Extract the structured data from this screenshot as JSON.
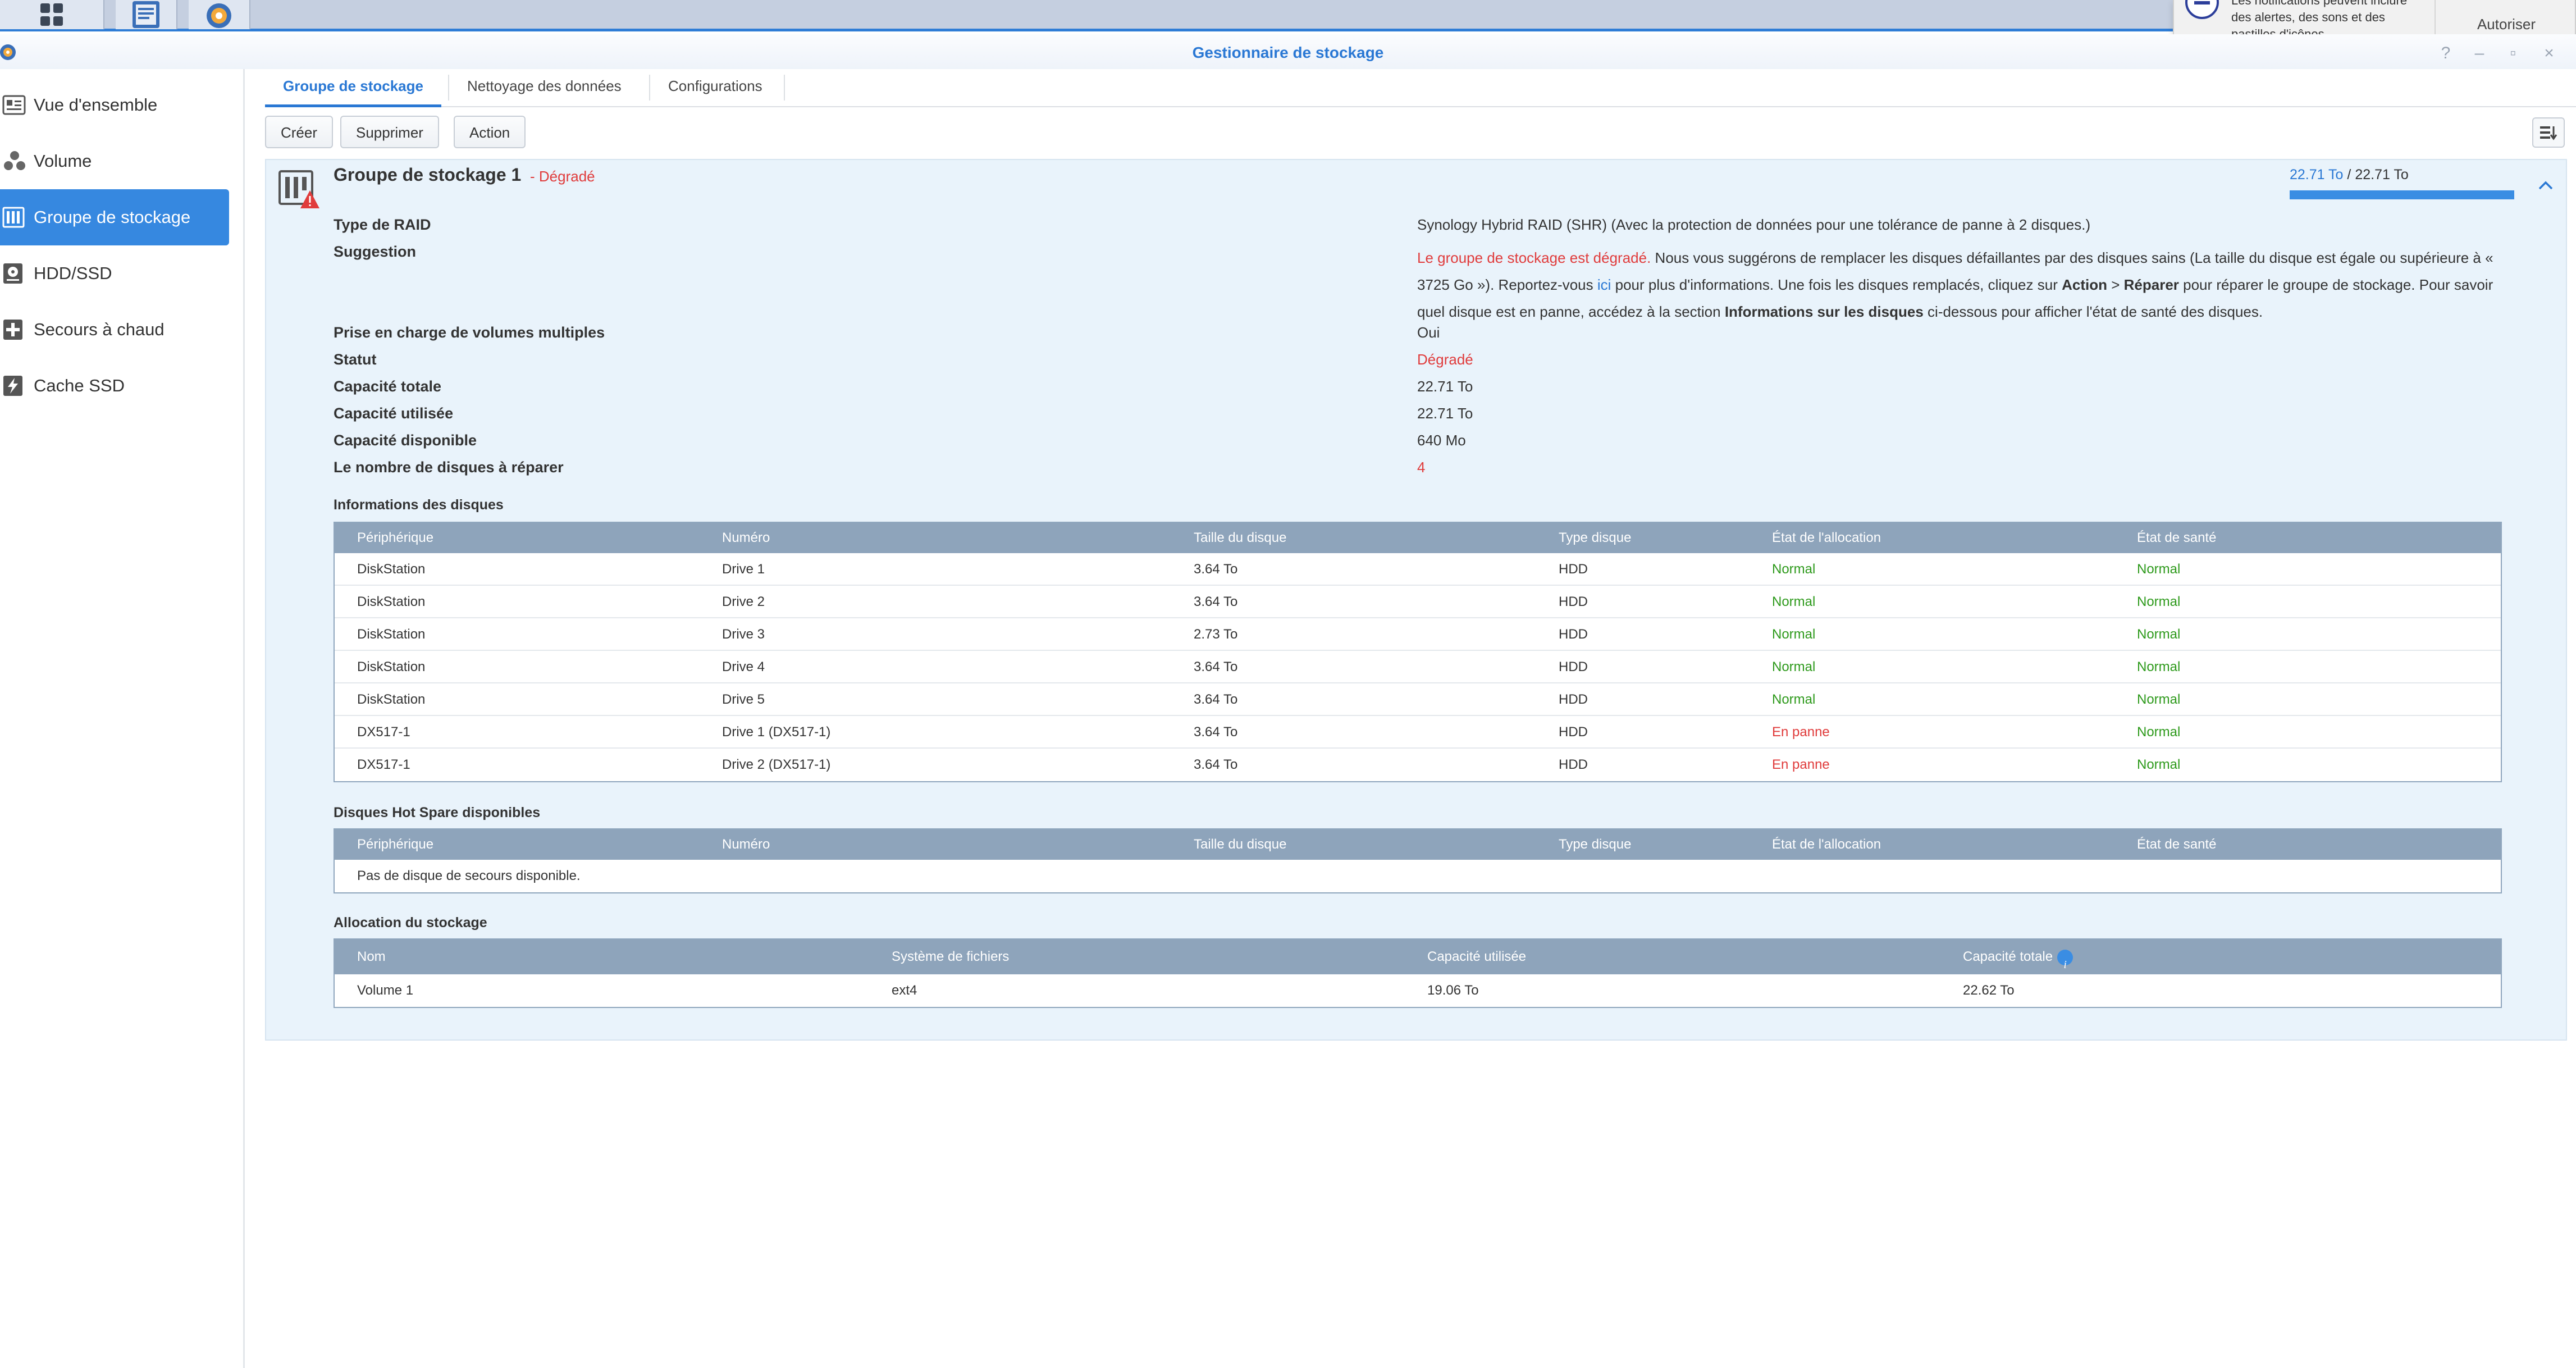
{
  "notification": {
    "text": "Les notifications peuvent inclure des alertes, des sons et des pastilles d'icônes.",
    "button": "Autoriser"
  },
  "window": {
    "title": "Gestionnaire de stockage",
    "controls": [
      "?",
      "–",
      "▫",
      "×"
    ]
  },
  "sidebar": {
    "items": [
      {
        "label": "Vue d'ensemble",
        "icon": "overview-icon"
      },
      {
        "label": "Volume",
        "icon": "volume-icon"
      },
      {
        "label": "Groupe de stockage",
        "icon": "storage-pool-icon",
        "active": true
      },
      {
        "label": "HDD/SSD",
        "icon": "hdd-icon"
      },
      {
        "label": "Secours à chaud",
        "icon": "hot-spare-icon"
      },
      {
        "label": "Cache SSD",
        "icon": "ssd-cache-icon"
      }
    ]
  },
  "tabs": [
    "Groupe de stockage",
    "Nettoyage des données",
    "Configurations"
  ],
  "toolbar": {
    "create": "Créer",
    "delete": "Supprimer",
    "action": "Action"
  },
  "pool": {
    "name": "Groupe de stockage 1",
    "status_suffix": "- Dégradé",
    "usage_used": "22.71 To",
    "usage_sep": " / ",
    "usage_total": "22.71 To",
    "usage_fraction": 1.0,
    "labels": {
      "raid_type": "Type de RAID",
      "suggestion": "Suggestion",
      "multi_volume": "Prise en charge de volumes multiples",
      "status": "Statut",
      "total_capacity": "Capacité totale",
      "used_capacity": "Capacité utilisée",
      "available_capacity": "Capacité disponible",
      "disks_to_repair": "Le nombre de disques à réparer"
    },
    "values": {
      "raid_type": "Synology Hybrid RAID (SHR) (Avec la protection de données pour une tolérance de panne à 2 disques.)",
      "multi_volume": "Oui",
      "status": "Dégradé",
      "total_capacity": "22.71 To",
      "used_capacity": "22.71 To",
      "available_capacity": "640 Mo",
      "disks_to_repair": "4"
    },
    "suggestion": {
      "p1_red": "Le groupe de stockage est dégradé.",
      "p2": " Nous vous suggérons de remplacer les disques défaillantes par des disques sains (La taille du disque est égale ou supérieure à « 3725 Go »). Reportez-vous ",
      "p3_link": "ici",
      "p4": " pour plus d'informations. Une fois les disques remplacés, cliquez sur ",
      "p5_bold": "Action",
      "p6": " > ",
      "p7_bold": "Réparer",
      "p8": " pour réparer le groupe de stockage. Pour savoir quel disque est en panne, accédez à la section ",
      "p9_bold": "Informations sur les disques",
      "p10": " ci-dessous pour afficher l'état de santé des disques."
    }
  },
  "disk_info": {
    "title": "Informations des disques",
    "columns": [
      "Périphérique",
      "Numéro",
      "Taille du disque",
      "Type disque",
      "État de l'allocation",
      "État de santé"
    ],
    "rows": [
      {
        "device": "DiskStation",
        "number": "Drive 1",
        "size": "3.64 To",
        "type": "HDD",
        "allocation": "Normal",
        "health": "Normal"
      },
      {
        "device": "DiskStation",
        "number": "Drive 2",
        "size": "3.64 To",
        "type": "HDD",
        "allocation": "Normal",
        "health": "Normal"
      },
      {
        "device": "DiskStation",
        "number": "Drive 3",
        "size": "2.73 To",
        "type": "HDD",
        "allocation": "Normal",
        "health": "Normal"
      },
      {
        "device": "DiskStation",
        "number": "Drive 4",
        "size": "3.64 To",
        "type": "HDD",
        "allocation": "Normal",
        "health": "Normal"
      },
      {
        "device": "DiskStation",
        "number": "Drive 5",
        "size": "3.64 To",
        "type": "HDD",
        "allocation": "Normal",
        "health": "Normal"
      },
      {
        "device": "DX517-1",
        "number": "Drive 1 (DX517-1)",
        "size": "3.64 To",
        "type": "HDD",
        "allocation": "En panne",
        "health": "Normal"
      },
      {
        "device": "DX517-1",
        "number": "Drive 2 (DX517-1)",
        "size": "3.64 To",
        "type": "HDD",
        "allocation": "En panne",
        "health": "Normal"
      }
    ]
  },
  "hot_spare": {
    "title": "Disques Hot Spare disponibles",
    "columns": [
      "Périphérique",
      "Numéro",
      "Taille du disque",
      "Type disque",
      "État de l'allocation",
      "État de santé"
    ],
    "empty": "Pas de disque de secours disponible."
  },
  "allocation": {
    "title": "Allocation du stockage",
    "columns": [
      "Nom",
      "Système de fichiers",
      "Capacité utilisée",
      "Capacité totale"
    ],
    "rows": [
      {
        "name": "Volume 1",
        "fs": "ext4",
        "used": "19.06 To",
        "total": "22.62 To"
      }
    ]
  },
  "colors": {
    "accent": "#2a78d4",
    "danger": "#e03c3c",
    "ok": "#2e9a1c",
    "grid_header": "#8ea4bb",
    "panel_bg": "#e9f3fb"
  }
}
